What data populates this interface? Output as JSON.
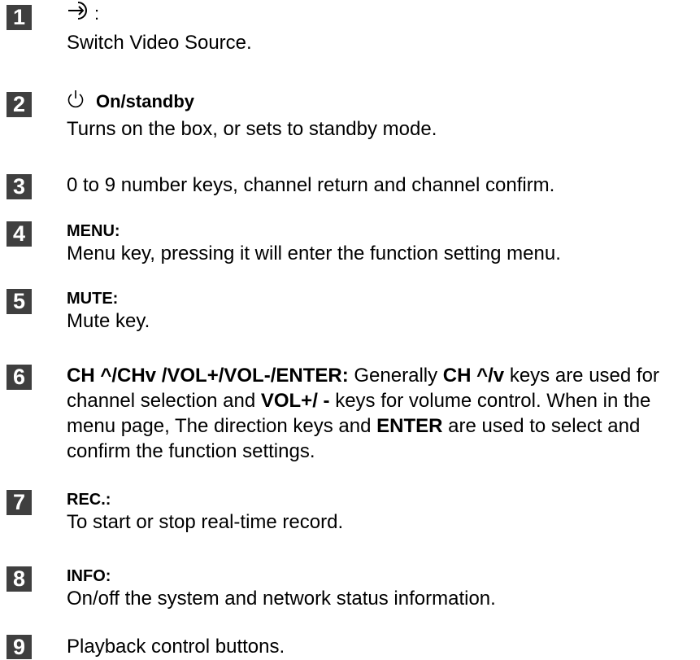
{
  "items": [
    {
      "number": "1",
      "heading_suffix": ":",
      "description": "Switch Video Source."
    },
    {
      "number": "2",
      "heading": "On/standby",
      "description": "Turns on the box, or sets to standby mode."
    },
    {
      "number": "3",
      "description": "0 to 9 number keys, channel return and channel confirm."
    },
    {
      "number": "4",
      "heading": "MENU:",
      "description": "Menu key, pressing it will enter the function setting menu."
    },
    {
      "number": "5",
      "heading": "MUTE:",
      "description": "Mute key."
    },
    {
      "number": "6",
      "parts": [
        "CH ^/CHv /VOL+/VOL-/ENTER:",
        " Generally ",
        "CH ^/v",
        " keys are used for channel selection and ",
        "VOL+/ -",
        " keys for volume control. When in the menu page, The direction keys and ",
        "ENTER",
        " are used to select and confirm the function settings."
      ]
    },
    {
      "number": "7",
      "heading": "REC.:",
      "description": "To start or stop real-time record."
    },
    {
      "number": "8",
      "heading": "INFO:",
      "description": "On/off the system and network status information."
    },
    {
      "number": "9",
      "description": "Playback control buttons."
    }
  ],
  "icons": {
    "item1": "input-source-icon",
    "item2": "power-icon"
  }
}
